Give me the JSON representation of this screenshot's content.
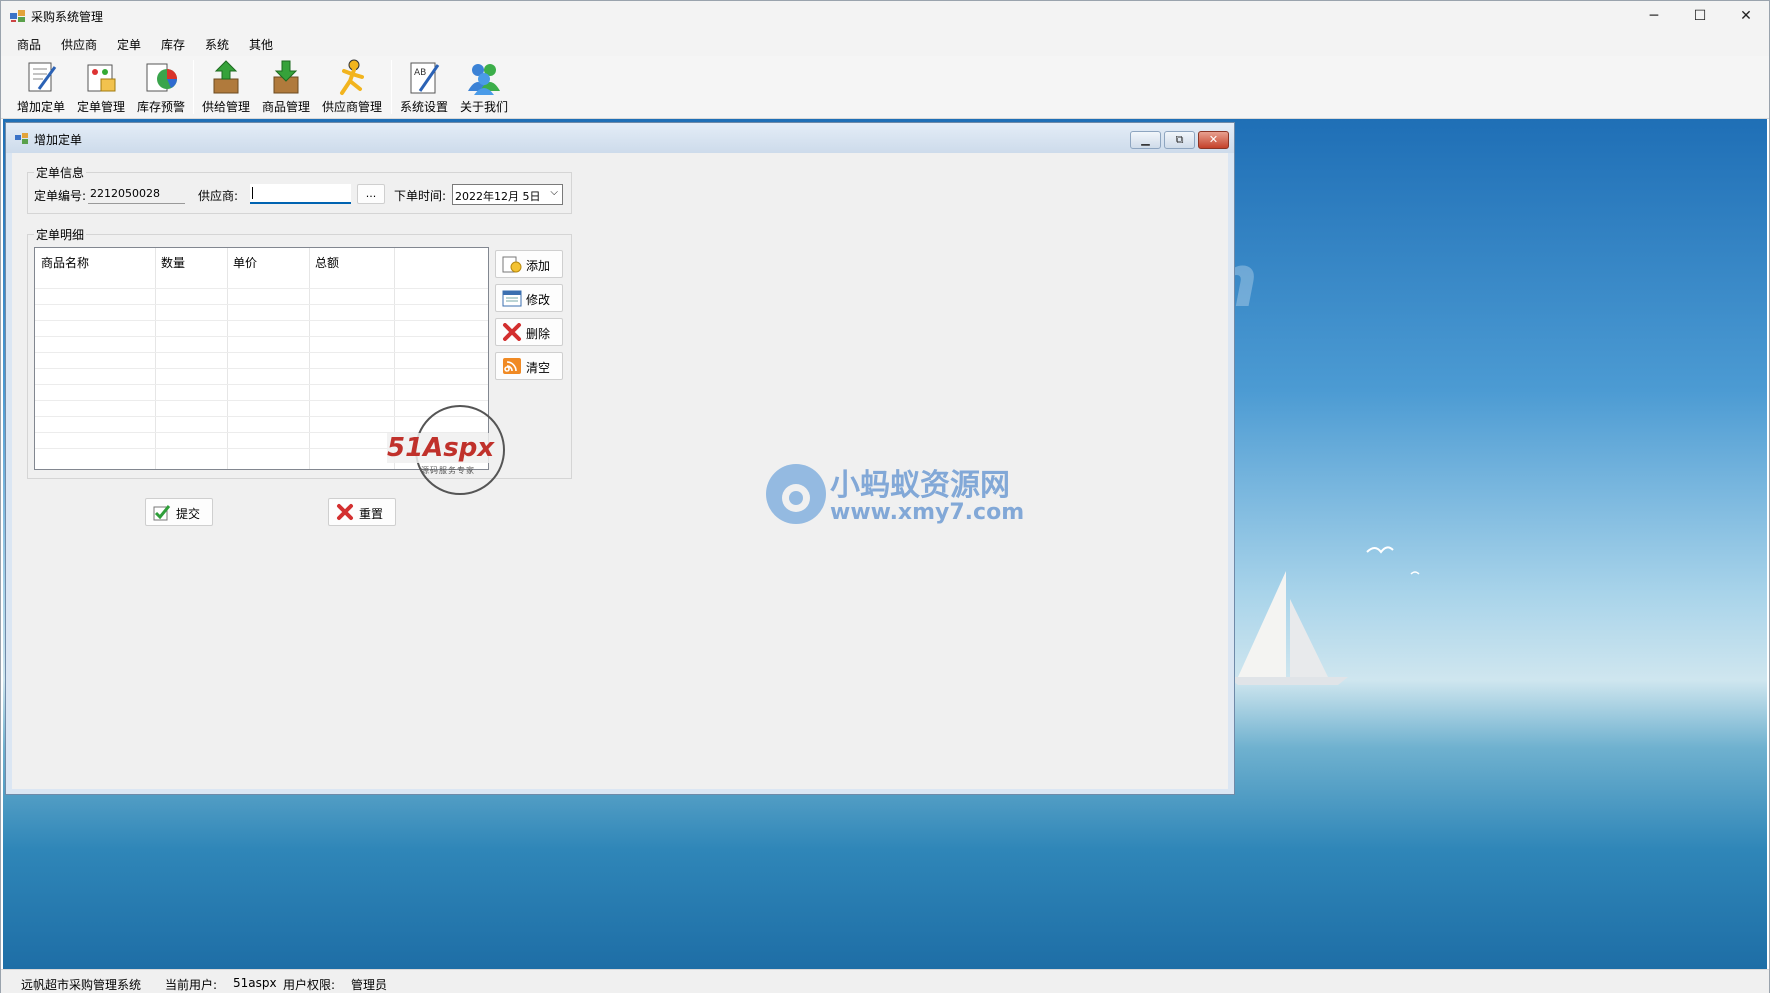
{
  "window": {
    "title": "采购系统管理",
    "minimize": "─",
    "maximize": "☐",
    "close": "✕"
  },
  "menu": [
    "商品",
    "供应商",
    "定单",
    "库存",
    "系统",
    "其他"
  ],
  "toolbar": [
    {
      "label": "增加定单",
      "icon": "add-order-icon"
    },
    {
      "label": "定单管理",
      "icon": "order-manage-icon"
    },
    {
      "label": "库存预警",
      "icon": "stock-alert-icon"
    },
    {
      "label": "供给管理",
      "icon": "supply-manage-icon"
    },
    {
      "label": "商品管理",
      "icon": "product-manage-icon"
    },
    {
      "label": "供应商管理",
      "icon": "supplier-manage-icon"
    },
    {
      "label": "系统设置",
      "icon": "system-settings-icon"
    },
    {
      "label": "关于我们",
      "icon": "about-us-icon"
    }
  ],
  "child": {
    "title": "增加定单",
    "info_group": "定单信息",
    "order_no_label": "定单编号:",
    "order_no": "2212050028",
    "supplier_label": "供应商:",
    "supplier_value": "",
    "browse_label": "...",
    "date_label": "下单时间:",
    "date_value": "2022年12月 5日",
    "detail_group": "定单明细",
    "columns": [
      "商品名称",
      "数量",
      "单价",
      "总额"
    ],
    "side_buttons": [
      {
        "label": "添加",
        "icon": "add-icon"
      },
      {
        "label": "修改",
        "icon": "edit-icon"
      },
      {
        "label": "删除",
        "icon": "delete-icon"
      },
      {
        "label": "清空",
        "icon": "clear-icon"
      }
    ],
    "submit_label": "提交",
    "reset_label": "重置"
  },
  "watermarks": {
    "logo_text": "51Aspx",
    "logo_sub": "源码服务专家",
    "site_name": "小蚂蚁资源网",
    "site_url": "www.xmy7.com"
  },
  "status": {
    "system_name": "远帆超市采购管理系统",
    "current_user_label": "当前用户:",
    "current_user": "51aspx",
    "role_label": "用户权限:",
    "role": "管理员"
  },
  "colors": {
    "accent": "#0063b1",
    "close": "#c4412b",
    "desktop": "#2f86b8"
  }
}
